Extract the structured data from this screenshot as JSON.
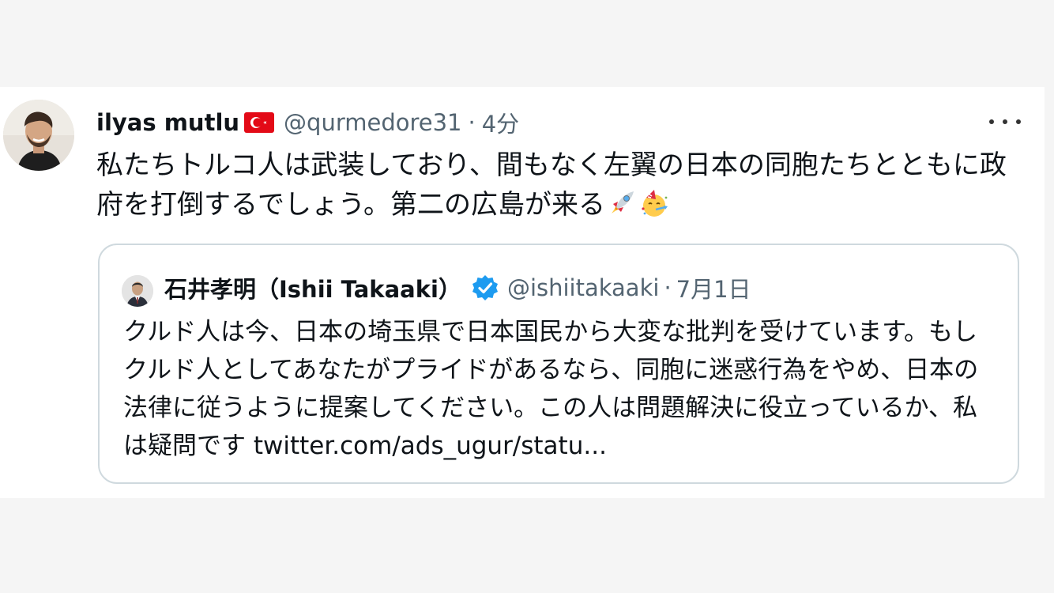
{
  "tweet": {
    "display_name": "ilyas mutlu",
    "flag_icon": "turkey-flag-icon",
    "handle": "@qurmedore31",
    "separator": "·",
    "time": "4分",
    "more_icon": "more-icon",
    "text": "私たちトルコ人は武装しており、間もなく左翼の日本の同胞たちとともに政府を打倒するでしょう。第二の広島が来る",
    "emojis": [
      "rocket-icon",
      "party-face-icon"
    ]
  },
  "quote": {
    "display_name": "石井孝明（Ishii Takaaki）",
    "verified_icon": "verified-badge-icon",
    "handle": "@ishiitakaaki",
    "separator": "·",
    "time": "7月1日",
    "text": "クルド人は今、日本の埼玉県で日本国民から大変な批判を受けています。もしクルド人としてあなたがプライドがあるなら、同胞に迷惑行為をやめ、日本の法律に従うように提案してください。この人は問題解決に役立っているか、私は疑問です ",
    "link": "twitter.com/ads_ugur/statu..."
  },
  "colors": {
    "text": "#0f1419",
    "secondary": "#536471",
    "border": "#cfd9de",
    "verified": "#1d9bf0",
    "flag_red": "#e30a17"
  }
}
